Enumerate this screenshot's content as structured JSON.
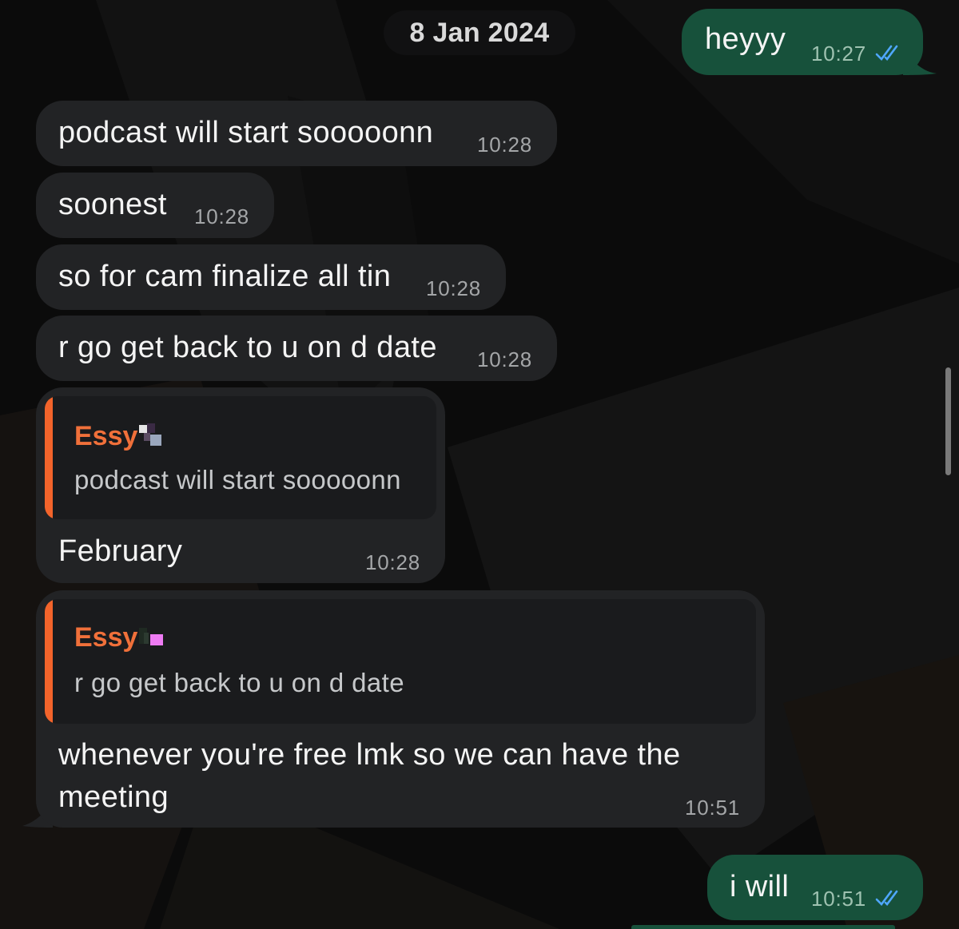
{
  "chat": {
    "date_separator": "8 Jan 2024",
    "messages": [
      {
        "direction": "outgoing",
        "text": "heyyy",
        "time": "10:27",
        "status": "read"
      },
      {
        "direction": "incoming",
        "text": "podcast will start sooooonn",
        "time": "10:28"
      },
      {
        "direction": "incoming",
        "text": "soonest",
        "time": "10:28"
      },
      {
        "direction": "incoming",
        "text": "so for cam finalize all tin",
        "time": "10:28"
      },
      {
        "direction": "incoming",
        "text": "r go get back to u on d date",
        "time": "10:28"
      },
      {
        "direction": "incoming",
        "reply_to": {
          "author": "Essy",
          "text": "podcast will start sooooonn"
        },
        "text": "February",
        "time": "10:28"
      },
      {
        "direction": "incoming",
        "reply_to": {
          "author": "Essy",
          "text": "r go get back to u on d date"
        },
        "text_line1": "whenever you're free lmk so we can have the",
        "text_line2": "meeting",
        "time": "10:51"
      },
      {
        "direction": "outgoing",
        "text": "i will",
        "time": "10:51",
        "status": "read"
      }
    ]
  },
  "colors": {
    "background": "#0b0b0b",
    "incoming_bubble": "#222325",
    "outgoing_bubble": "#17513b",
    "reply_accent": "#f3642b",
    "read_ticks": "#4fa7ff"
  },
  "icons": {
    "read_status": "double-check-icon",
    "author_emoji_1": "sticker-emoji-icon",
    "author_emoji_2": "sticker-emoji-icon"
  }
}
